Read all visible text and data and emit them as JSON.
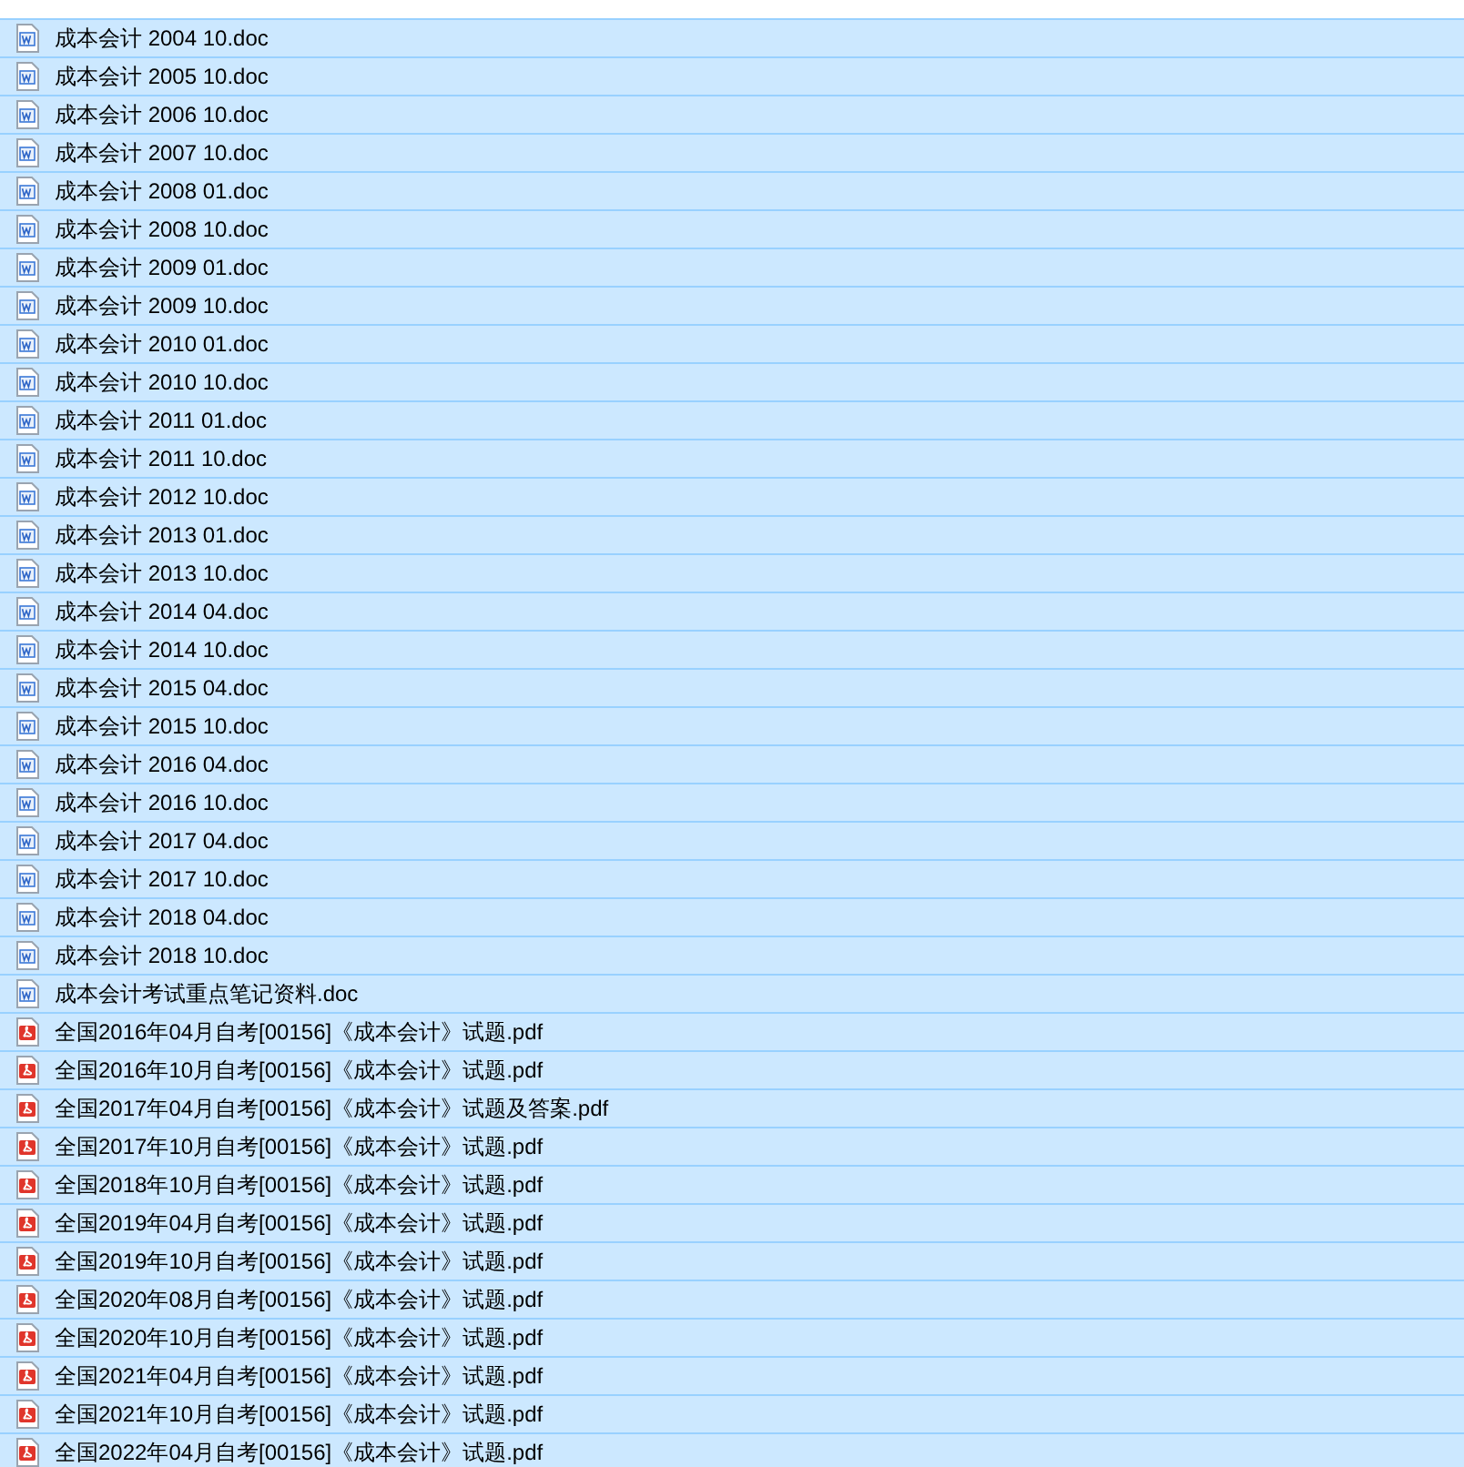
{
  "files": [
    {
      "name": "成本会计 2004 10.doc",
      "kind": "doc",
      "selected": true
    },
    {
      "name": "成本会计 2005 10.doc",
      "kind": "doc",
      "selected": true
    },
    {
      "name": "成本会计 2006 10.doc",
      "kind": "doc",
      "selected": true
    },
    {
      "name": "成本会计 2007 10.doc",
      "kind": "doc",
      "selected": true
    },
    {
      "name": "成本会计 2008 01.doc",
      "kind": "doc",
      "selected": true
    },
    {
      "name": "成本会计 2008 10.doc",
      "kind": "doc",
      "selected": true
    },
    {
      "name": "成本会计 2009 01.doc",
      "kind": "doc",
      "selected": true
    },
    {
      "name": "成本会计 2009 10.doc",
      "kind": "doc",
      "selected": true
    },
    {
      "name": "成本会计 2010 01.doc",
      "kind": "doc",
      "selected": true
    },
    {
      "name": "成本会计 2010 10.doc",
      "kind": "doc",
      "selected": true
    },
    {
      "name": "成本会计 2011 01.doc",
      "kind": "doc",
      "selected": true
    },
    {
      "name": "成本会计 2011 10.doc",
      "kind": "doc",
      "selected": true
    },
    {
      "name": "成本会计 2012 10.doc",
      "kind": "doc",
      "selected": true
    },
    {
      "name": "成本会计 2013 01.doc",
      "kind": "doc",
      "selected": true
    },
    {
      "name": "成本会计 2013 10.doc",
      "kind": "doc",
      "selected": true
    },
    {
      "name": "成本会计 2014 04.doc",
      "kind": "doc",
      "selected": true
    },
    {
      "name": "成本会计 2014 10.doc",
      "kind": "doc",
      "selected": true
    },
    {
      "name": "成本会计 2015 04.doc",
      "kind": "doc",
      "selected": true
    },
    {
      "name": "成本会计 2015 10.doc",
      "kind": "doc",
      "selected": true
    },
    {
      "name": "成本会计 2016 04.doc",
      "kind": "doc",
      "selected": true
    },
    {
      "name": "成本会计 2016 10.doc",
      "kind": "doc",
      "selected": true
    },
    {
      "name": "成本会计 2017 04.doc",
      "kind": "doc",
      "selected": true
    },
    {
      "name": "成本会计 2017 10.doc",
      "kind": "doc",
      "selected": true
    },
    {
      "name": "成本会计 2018 04.doc",
      "kind": "doc",
      "selected": true
    },
    {
      "name": "成本会计 2018 10.doc",
      "kind": "doc",
      "selected": true
    },
    {
      "name": "成本会计考试重点笔记资料.doc",
      "kind": "doc",
      "selected": true
    },
    {
      "name": "全国2016年04月自考[00156]《成本会计》试题.pdf",
      "kind": "pdf",
      "selected": true
    },
    {
      "name": "全国2016年10月自考[00156]《成本会计》试题.pdf",
      "kind": "pdf",
      "selected": true
    },
    {
      "name": "全国2017年04月自考[00156]《成本会计》试题及答案.pdf",
      "kind": "pdf",
      "selected": true
    },
    {
      "name": "全国2017年10月自考[00156]《成本会计》试题.pdf",
      "kind": "pdf",
      "selected": true
    },
    {
      "name": "全国2018年10月自考[00156]《成本会计》试题.pdf",
      "kind": "pdf",
      "selected": true
    },
    {
      "name": "全国2019年04月自考[00156]《成本会计》试题.pdf",
      "kind": "pdf",
      "selected": true
    },
    {
      "name": "全国2019年10月自考[00156]《成本会计》试题.pdf",
      "kind": "pdf",
      "selected": true
    },
    {
      "name": "全国2020年08月自考[00156]《成本会计》试题.pdf",
      "kind": "pdf",
      "selected": true
    },
    {
      "name": "全国2020年10月自考[00156]《成本会计》试题.pdf",
      "kind": "pdf",
      "selected": true
    },
    {
      "name": "全国2021年04月自考[00156]《成本会计》试题.pdf",
      "kind": "pdf",
      "selected": true
    },
    {
      "name": "全国2021年10月自考[00156]《成本会计》试题.pdf",
      "kind": "pdf",
      "selected": true
    },
    {
      "name": "全国2022年04月自考[00156]《成本会计》试题.pdf",
      "kind": "pdf",
      "selected": true
    }
  ]
}
